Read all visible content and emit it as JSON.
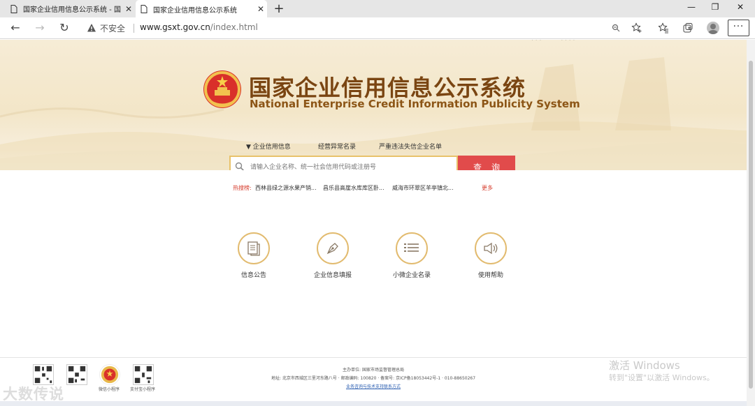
{
  "browser": {
    "tabs": [
      {
        "title": "国家企业信用信息公示系统 - 国",
        "active": false
      },
      {
        "title": "国家企业信用信息公示系统",
        "active": true
      }
    ],
    "insecure_label": "不安全",
    "url_main": "www.gsxt.gov.cn",
    "url_path": "/index.html",
    "more_label": "···"
  },
  "header": {
    "title_cn": "国家企业信用信息公示系统",
    "title_en": "National Enterprise Credit Information Publicity System"
  },
  "search": {
    "tabs": [
      "▼ 企业信用信息",
      "经营异常名录",
      "严重违法失信企业名单"
    ],
    "placeholder": "请输入企业名称、统一社会信用代码或注册号",
    "button_label": "查询",
    "hot_label": "热搜榜:",
    "hot_items": [
      "西林县绿之源水果产销...",
      "昌乐县高崖水库库区卧...",
      "威海市环翠区羊亭镇北..."
    ],
    "more_label": "更多"
  },
  "features": [
    {
      "label": "信息公告",
      "icon": "document-icon"
    },
    {
      "label": "企业信息填报",
      "icon": "pen-icon"
    },
    {
      "label": "小微企业名录",
      "icon": "list-icon"
    },
    {
      "label": "使用帮助",
      "icon": "speaker-icon"
    }
  ],
  "footer": {
    "qr_labels": [
      "微信小程序",
      "支付宝小程序"
    ],
    "host": "主办单位: 国家市场监督管理总局",
    "address": "地址: 北京市西城区三里河东路八号 · 邮政编码: 100820 · 备案号: 京ICP备18053442号-1 · 010-88650267",
    "link": "业务咨询与技术支持联系方式"
  },
  "watermark": {
    "line1": "激活 Windows",
    "line2": "转到\"设置\"以激活 Windows。",
    "source": "大数传说"
  },
  "colors": {
    "accent_red": "#e14b4b",
    "title_brown": "#7a4512",
    "gold_border": "#e2bb6f"
  }
}
